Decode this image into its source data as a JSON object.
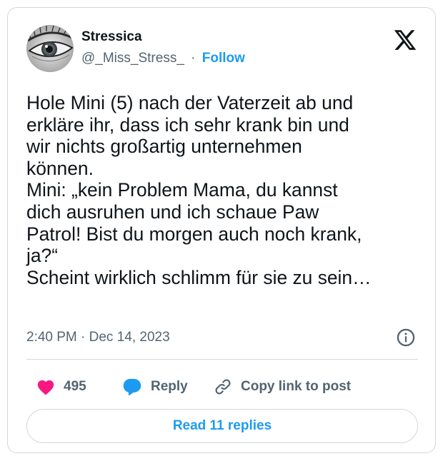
{
  "author": {
    "name": "Stressica",
    "handle": "@_Miss_Stress_",
    "separator": "·",
    "follow_label": "Follow"
  },
  "icons": {
    "platform": "x-logo-icon",
    "info": "info-icon",
    "like": "heart-icon",
    "reply": "reply-bubble-icon",
    "copy": "link-icon"
  },
  "tweet": {
    "lines": [
      "Hole Mini (5) nach der Vaterzeit ab und",
      "erkläre ihr, dass ich sehr krank bin und",
      "wir nichts großartig unternehmen",
      "können.",
      "Mini: „kein Problem Mama, du kannst",
      "dich ausruhen und ich schaue Paw",
      "Patrol! Bist du morgen auch noch krank,",
      "ja?“",
      "Scheint wirklich schlimm für sie zu sein…"
    ],
    "timestamp": "2:40 PM · Dec 14, 2023"
  },
  "actions": {
    "likes": "495",
    "reply_label": "Reply",
    "copy_label": "Copy link to post"
  },
  "read_replies_label": "Read 11 replies",
  "colors": {
    "accent": "#1d9bf0",
    "like": "#f91880",
    "text": "#0f1419",
    "muted": "#536471",
    "border": "#cfd9de"
  }
}
